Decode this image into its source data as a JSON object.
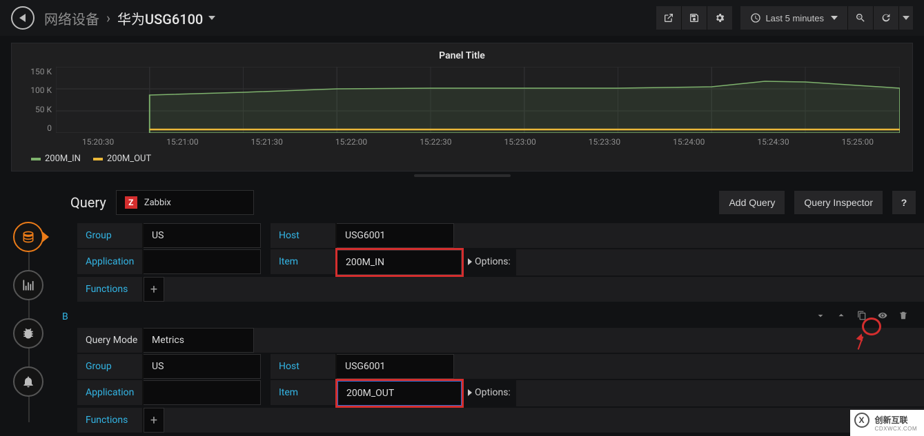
{
  "nav": {
    "breadcrumb1": "网络设备",
    "breadcrumb2": "华为USG6100",
    "time_label": "Last 5 minutes"
  },
  "panel": {
    "title": "Panel Title"
  },
  "chart_data": {
    "type": "line",
    "title": "Panel Title",
    "xlabel": "",
    "ylabel": "",
    "ylim": [
      0,
      150000
    ],
    "y_ticks": [
      "150 K",
      "100 K",
      "50 K",
      "0"
    ],
    "x_ticks": [
      "15:20:30",
      "15:21:00",
      "15:21:30",
      "15:22:00",
      "15:22:30",
      "15:23:00",
      "15:23:30",
      "15:24:00",
      "15:24:30",
      "15:25:00"
    ],
    "x": [
      "15:21:00",
      "15:21:30",
      "15:22:00",
      "15:22:30",
      "15:23:00",
      "15:23:30",
      "15:24:00",
      "15:24:30",
      "15:25:00"
    ],
    "series": [
      {
        "name": "200M_IN",
        "color": "#7eb26d",
        "values": [
          85000,
          92000,
          100000,
          101000,
          102000,
          101000,
          105000,
          118000,
          116000,
          102000
        ]
      },
      {
        "name": "200M_OUT",
        "color": "#eab839",
        "values": [
          8000,
          8000,
          8000,
          8000,
          8000,
          8000,
          8000,
          8000,
          8000,
          8000
        ]
      }
    ],
    "legend_position": "bottom-left",
    "grid": true
  },
  "editor": {
    "query_tab_label": "Query",
    "datasource": "Zabbix",
    "add_query_label": "Add Query",
    "inspector_label": "Query Inspector",
    "help_label": "?",
    "labels": {
      "group": "Group",
      "host": "Host",
      "application": "Application",
      "item": "Item",
      "functions": "Functions",
      "options": "Options:",
      "query_mode": "Query Mode"
    },
    "queryA": {
      "group": "US",
      "host": "USG6001",
      "application": "",
      "item": "200M_IN"
    },
    "queryB": {
      "ref": "B",
      "query_mode": "Metrics",
      "group": "US",
      "host": "USG6001",
      "application": "",
      "item": "200M_OUT"
    }
  },
  "watermark": {
    "cn": "创新互联",
    "en": "CDXWCX.COM",
    "logo": "X"
  }
}
